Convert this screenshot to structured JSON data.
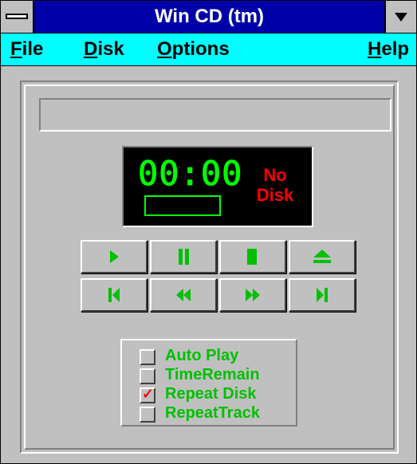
{
  "window": {
    "title": "Win CD (tm)"
  },
  "menu": {
    "file": {
      "accel": "F",
      "rest": "ile"
    },
    "disk": {
      "accel": "D",
      "rest": "isk"
    },
    "options": {
      "accel": "O",
      "rest": "ptions"
    },
    "help": {
      "accel": "H",
      "rest": "elp"
    }
  },
  "display": {
    "time": "00:00",
    "status_line1": "No",
    "status_line2": "Disk",
    "track": ""
  },
  "status_bar": {
    "text": ""
  },
  "buttons": {
    "row1": [
      {
        "icon": "play-icon"
      },
      {
        "icon": "pause-icon"
      },
      {
        "icon": "stop-icon"
      },
      {
        "icon": "eject-icon"
      }
    ],
    "row2": [
      {
        "icon": "previous-track-icon"
      },
      {
        "icon": "rewind-icon"
      },
      {
        "icon": "fast-forward-icon"
      },
      {
        "icon": "next-track-icon"
      }
    ]
  },
  "options": [
    {
      "label": "Auto Play",
      "checked": false
    },
    {
      "label": "TimeRemain",
      "checked": false
    },
    {
      "label": "Repeat Disk",
      "checked": true
    },
    {
      "label": "RepeatTrack",
      "checked": false
    }
  ],
  "colors": {
    "titlebar": "#0000a8",
    "menubar": "#00ffff",
    "icon_green": "#00c000",
    "lcd_green": "#00ff00",
    "alert_red": "#ff0000",
    "face": "#c0c0c0"
  }
}
